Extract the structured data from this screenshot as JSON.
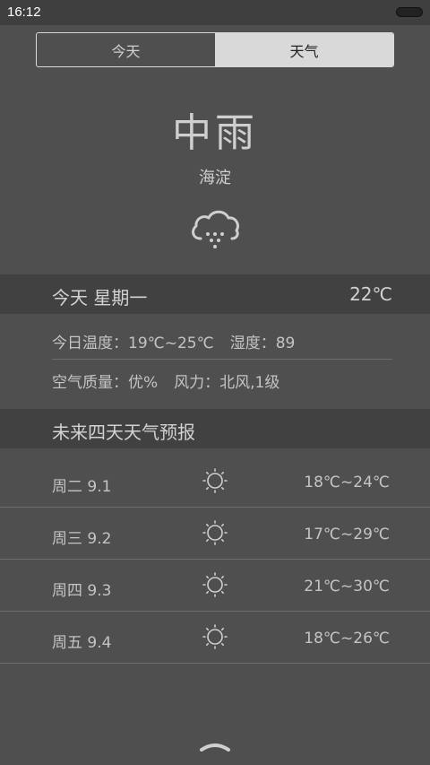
{
  "status": {
    "time": "16:12"
  },
  "tabs": [
    {
      "label": "今天",
      "active": false
    },
    {
      "label": "天气",
      "active": true
    }
  ],
  "current": {
    "condition": "中雨",
    "location": "海淀",
    "icon": "cloud-rain-icon"
  },
  "today": {
    "label": "今天 星期一",
    "temp": "22℃",
    "temp_range": "今日温度：19℃~25℃",
    "humidity": "湿度：89",
    "air_quality": "空气质量：优%",
    "wind": "风力：北风,1级"
  },
  "forecast": {
    "title": "未来四天天气预报",
    "days": [
      {
        "day": "周二 9.1",
        "icon": "sun-icon",
        "temp": "18℃~24℃"
      },
      {
        "day": "周三 9.2",
        "icon": "sun-icon",
        "temp": "17℃~29℃"
      },
      {
        "day": "周四 9.3",
        "icon": "sun-icon",
        "temp": "21℃~30℃"
      },
      {
        "day": "周五 9.4",
        "icon": "sun-icon",
        "temp": "18℃~26℃"
      }
    ]
  },
  "colors": {
    "background": "#4f4f4f",
    "header_band": "#414141",
    "active_tab": "#d9d9d9"
  }
}
